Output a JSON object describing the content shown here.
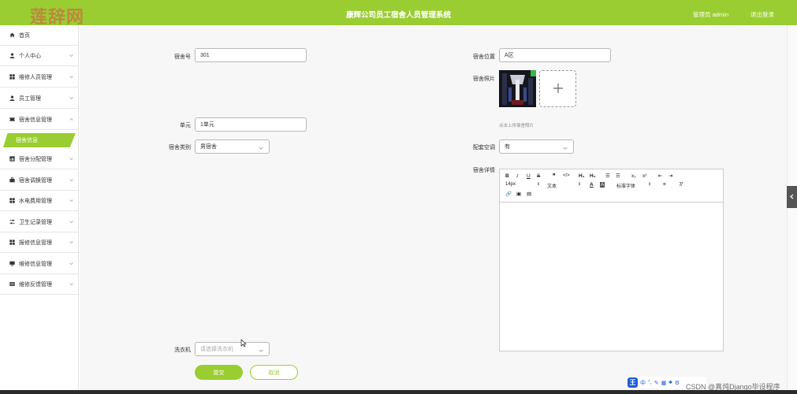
{
  "header": {
    "logo_text": "莲辞网",
    "app_title": "康辉公司员工宿舍人员管理系统",
    "user_label": "管理员 admin",
    "logout_label": "退出登录",
    "accent_color": "#9acd32"
  },
  "sidebar": {
    "items": [
      {
        "label": "首页",
        "icon": "home-icon"
      },
      {
        "label": "个人中心",
        "icon": "user-icon"
      },
      {
        "label": "维修人员管理",
        "icon": "grid-icon"
      },
      {
        "label": "员工管理",
        "icon": "user-icon"
      },
      {
        "label": "宿舍信息管理",
        "icon": "ticket-icon"
      },
      {
        "label": "宿舍分配管理",
        "icon": "chart-icon"
      },
      {
        "label": "宿舍调换管理",
        "icon": "briefcase-icon"
      },
      {
        "label": "水电费用管理",
        "icon": "grid-icon"
      },
      {
        "label": "卫生记录管理",
        "icon": "sliders-icon"
      },
      {
        "label": "报修信息管理",
        "icon": "grid-icon"
      },
      {
        "label": "维修信息管理",
        "icon": "monitor-icon"
      },
      {
        "label": "维修反馈管理",
        "icon": "list-icon"
      }
    ],
    "active_sub": "宿舍信息"
  },
  "form": {
    "dorm_no": {
      "label": "宿舍号",
      "value": "301"
    },
    "dorm_location": {
      "label": "宿舍位置",
      "value": "A区"
    },
    "dorm_photo": {
      "label": "宿舍照片",
      "hint": "点击上传宿舍照片"
    },
    "unit": {
      "label": "单元",
      "value": "1单元"
    },
    "dorm_type": {
      "label": "宿舍类别",
      "value": "男宿舍"
    },
    "aircon": {
      "label": "配套空调",
      "value": "有"
    },
    "dorm_detail": {
      "label": "宿舍详情"
    },
    "washer": {
      "label": "洗衣机",
      "placeholder": "请选择洗衣机"
    }
  },
  "editor": {
    "font_size": "14px",
    "text_type": "文本",
    "font_family": "标准字体"
  },
  "buttons": {
    "submit": "提交",
    "cancel": "取消"
  },
  "ime": {
    "logo": "王",
    "mode": "中"
  },
  "watermark": "CSDN @真炖Django毕设程序"
}
